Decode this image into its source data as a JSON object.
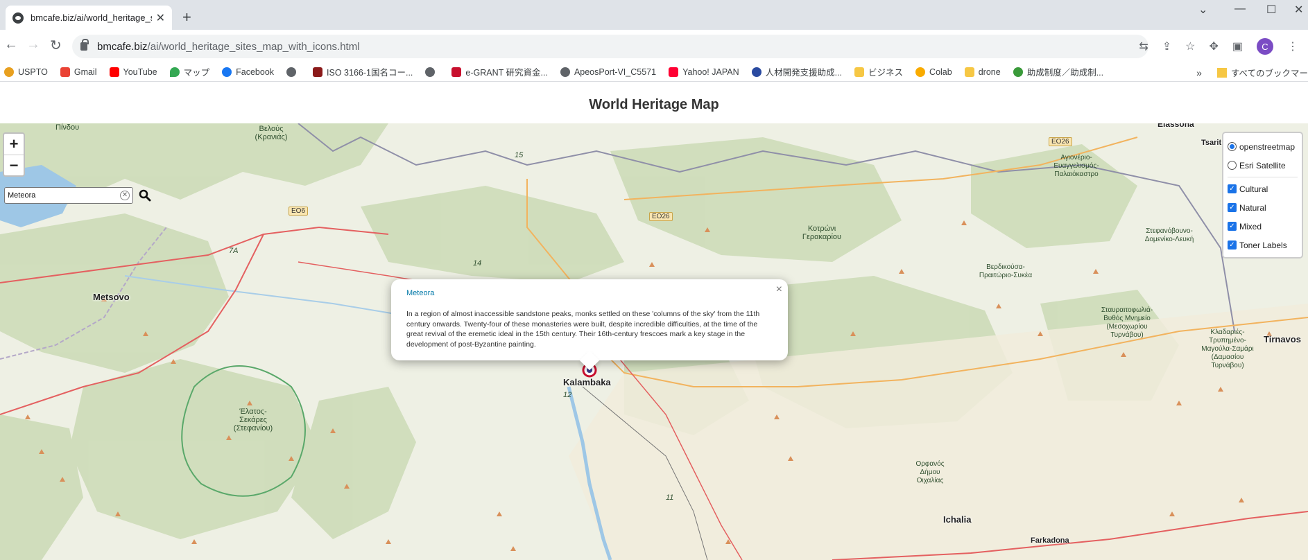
{
  "browser": {
    "tab_title": "bmcafe.biz/ai/world_heritage_sit",
    "url_host": "bmcafe.biz",
    "url_path": "/ai/world_heritage_sites_map_with_icons.html",
    "profile_initial": "C",
    "bookmarks": [
      "USPTO",
      "Gmail",
      "YouTube",
      "マップ",
      "Facebook",
      "",
      "ISO 3166-1国名コー...",
      "",
      "e-GRANT 研究資金...",
      "ApeosPort-VI_C5571",
      "Yahoo! JAPAN",
      "人材開発支援助成...",
      "ビジネス",
      "Colab",
      "drone",
      "助成制度／助成制..."
    ],
    "bookmarks_all": "すべてのブックマー"
  },
  "page": {
    "title": "World Heritage Map"
  },
  "map": {
    "zoom_in": "+",
    "zoom_out": "−",
    "search_value": "Meteora",
    "layers": {
      "base": [
        {
          "label": "openstreetmap",
          "selected": true
        },
        {
          "label": "Esri Satellite",
          "selected": false
        }
      ],
      "overlays": [
        {
          "label": "Cultural",
          "checked": true
        },
        {
          "label": "Natural",
          "checked": true
        },
        {
          "label": "Mixed",
          "checked": true
        },
        {
          "label": "Toner Labels",
          "checked": true
        }
      ]
    },
    "popup": {
      "title": "Meteora",
      "description": "In a region of almost inaccessible sandstone peaks, monks settled on these 'columns of the sky' from the 11th century onwards. Twenty-four of these monasteries were built, despite incredible difficulties, at the time of the great revival of the eremetic ideal in the 15th century. Their 16th-century frescoes mark a key stage in the development of post-Byzantine painting.",
      "close": "×"
    },
    "labels": {
      "pindou": "Πίνδου",
      "velou": "Βελούς (Κρανιάς)",
      "metsovo": "Metsovo",
      "elassona": "Elassona",
      "tsarit": "Tsarit",
      "kalambaka": "Kalambaka",
      "timavos": "Tirnavos",
      "ichalia": "Ichalia",
      "farkadona": "Farkadona",
      "elatos": "Έλατος-Σεκάρες (Στεφανίου)",
      "kotrwni": "Κοτρώνι Γερακαρίου",
      "agioneri": "Αγιονέριο-Ευαγγελισμός-Παλαιόκαστρο",
      "verdikousa": "Βερδικούσα-Πραιτώριο-Συκέα",
      "stefanovouno": "Στεφανόβουνο-Δομενίκο-Λευκή",
      "stavraitophylia": "Σταυραιτοφωλιά-Βυθός Μνημείο (Μεσοχωρίου Τυρνάβου)",
      "kladaries": "Κλαδαριές-Τρυπημένο-Μαγούλα-Σαμάρι (Δαμασίου Τυρνάβου)",
      "orfanos": "Ορφανός Δήμου Οιχαλίας",
      "road_eo6": "EO6",
      "road_eo26a": "EO26",
      "road_eo26b": "EO26",
      "r15": "15",
      "r14": "14",
      "r7a": "7A",
      "r12": "12",
      "r11": "11"
    }
  }
}
